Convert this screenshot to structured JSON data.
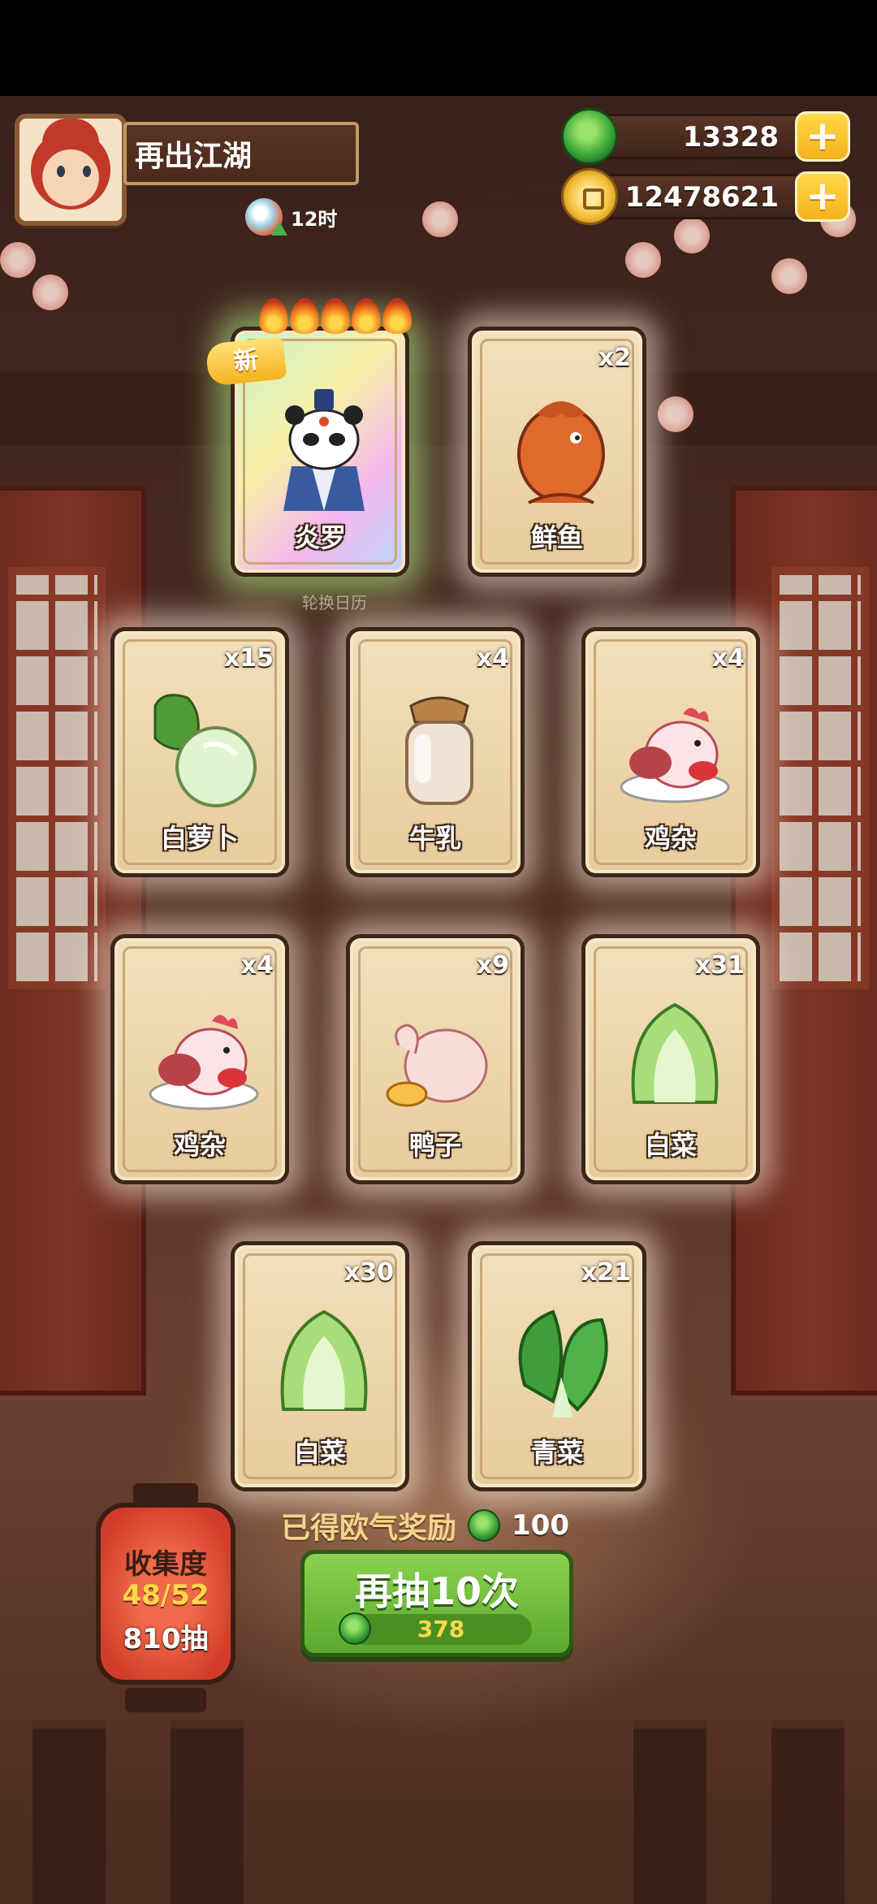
{
  "header": {
    "player_name": "再出江湖",
    "timer_text": "12时"
  },
  "currencies": {
    "jade": "13328",
    "coins": "12478621"
  },
  "top_cards": [
    {
      "name": "炎罗",
      "count": "",
      "badge": "新",
      "rarity": "special",
      "icon": "panda-hero-art"
    },
    {
      "name": "鲜鱼",
      "count": "x2",
      "icon": "fish-art"
    }
  ],
  "under_label": "轮换日历",
  "grid_cards": [
    {
      "name": "白萝卜",
      "count": "x15",
      "icon": "radish-art"
    },
    {
      "name": "牛乳",
      "count": "x4",
      "icon": "milk-jar-art"
    },
    {
      "name": "鸡杂",
      "count": "x4",
      "icon": "chicken-art"
    },
    {
      "name": "鸡杂",
      "count": "x4",
      "icon": "chicken-art"
    },
    {
      "name": "鸭子",
      "count": "x9",
      "icon": "duck-art"
    },
    {
      "name": "白菜",
      "count": "x31",
      "icon": "cabbage-art"
    },
    {
      "name": "白菜",
      "count": "x30",
      "icon": "cabbage-art"
    },
    {
      "name": "青菜",
      "count": "x21",
      "icon": "bokchoy-art"
    }
  ],
  "reward": {
    "label": "已得欧气奖励",
    "value": "100"
  },
  "collection": {
    "title": "收集度",
    "progress": "48/52",
    "draws": "810抽"
  },
  "draw_button": {
    "label": "再抽10次",
    "cost": "378"
  },
  "colors": {
    "card_bg": "#f2e0bd",
    "button_green": "#6cbf3a",
    "gold": "#f5b21c",
    "jade_green": "#3ea83a"
  }
}
